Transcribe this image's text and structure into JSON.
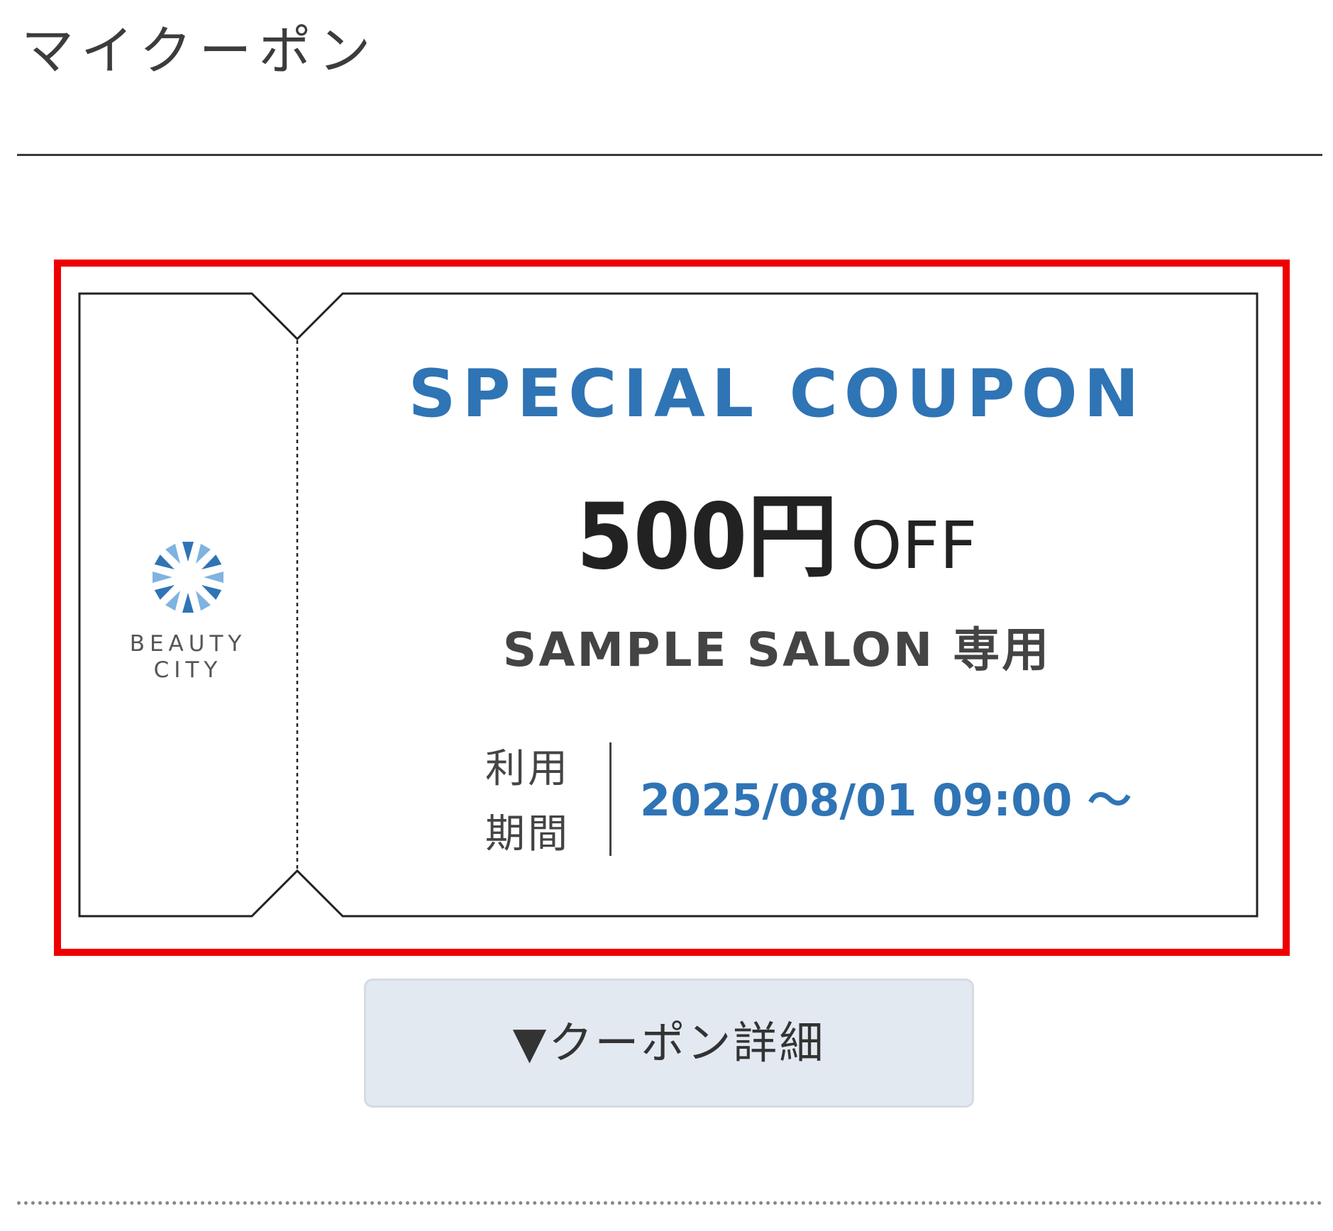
{
  "page": {
    "title": "マイクーポン"
  },
  "coupon": {
    "brand": {
      "name": "BEAUTY\nCITY",
      "logo_icon": "beauty-city-burst-logo",
      "colors": [
        "#7fb3e0",
        "#2f74b5"
      ]
    },
    "heading": "SPECIAL COUPON",
    "discount_amount": "500円",
    "discount_suffix": "OFF",
    "salon_label": "SAMPLE SALON 専用",
    "period_label": "利用\n期間",
    "period_value": "2025/08/01 09:00 〜"
  },
  "details_button": {
    "label": "▼クーポン詳細"
  },
  "colors": {
    "accent_blue": "#2f74b5",
    "highlight_red": "#ee0000",
    "button_bg": "#e3e9f1"
  }
}
